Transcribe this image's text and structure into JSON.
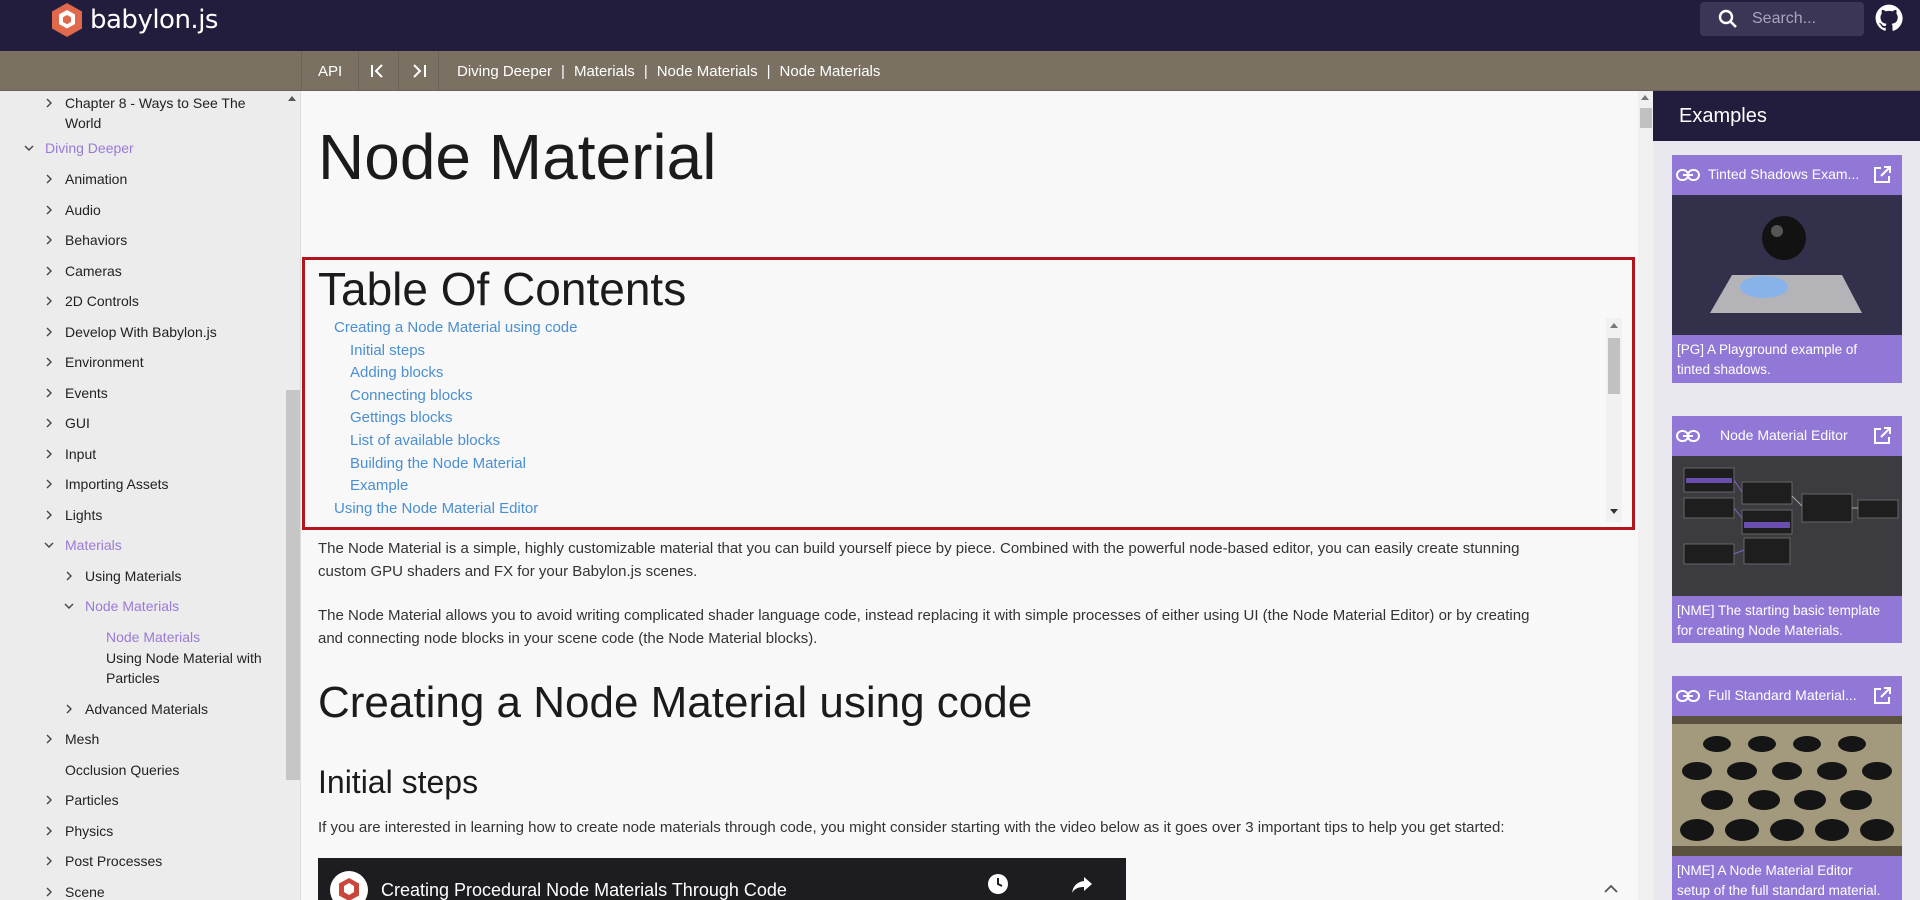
{
  "header": {
    "logo_text": "babylon.js",
    "search_placeholder": "Search..."
  },
  "toolbar": {
    "api_label": "API",
    "prev_icon": "first-page-icon",
    "next_icon": "last-page-icon",
    "breadcrumbs": [
      "Diving Deeper",
      "Materials",
      "Node Materials",
      "Node Materials"
    ],
    "separator": "|"
  },
  "sidebar": {
    "items": [
      {
        "label": "Chapter 8 - Ways to See The",
        "label2": "World",
        "chevron": "right"
      },
      {
        "label": "Diving Deeper",
        "chevron": "down",
        "active": true
      },
      {
        "label": "Animation",
        "chevron": "right"
      },
      {
        "label": "Audio",
        "chevron": "right"
      },
      {
        "label": "Behaviors",
        "chevron": "right"
      },
      {
        "label": "Cameras",
        "chevron": "right"
      },
      {
        "label": "2D Controls",
        "chevron": "right"
      },
      {
        "label": "Develop With Babylon.js",
        "chevron": "right"
      },
      {
        "label": "Environment",
        "chevron": "right"
      },
      {
        "label": "Events",
        "chevron": "right"
      },
      {
        "label": "GUI",
        "chevron": "right"
      },
      {
        "label": "Input",
        "chevron": "right"
      },
      {
        "label": "Importing Assets",
        "chevron": "right"
      },
      {
        "label": "Lights",
        "chevron": "right"
      },
      {
        "label": "Materials",
        "chevron": "down",
        "active": true
      },
      {
        "label": "Using Materials",
        "chevron": "right"
      },
      {
        "label": "Node Materials",
        "chevron": "down",
        "active": true
      },
      {
        "label": "Node Materials",
        "active": true
      },
      {
        "label": "Using Node Material with",
        "label2": "Particles"
      },
      {
        "label": "Advanced Materials",
        "chevron": "right"
      },
      {
        "label": "Mesh",
        "chevron": "right"
      },
      {
        "label": "Occlusion Queries"
      },
      {
        "label": "Particles",
        "chevron": "right"
      },
      {
        "label": "Physics",
        "chevron": "right"
      },
      {
        "label": "Post Processes",
        "chevron": "right"
      },
      {
        "label": "Scene",
        "chevron": "right"
      }
    ]
  },
  "main": {
    "title": "Node Material",
    "toc_title": "Table Of Contents",
    "toc": [
      {
        "label": "Creating a Node Material using code",
        "level": 1
      },
      {
        "label": "Initial steps",
        "level": 2
      },
      {
        "label": "Adding blocks",
        "level": 2
      },
      {
        "label": "Connecting blocks",
        "level": 2
      },
      {
        "label": "Gettings blocks",
        "level": 2
      },
      {
        "label": "List of available blocks",
        "level": 2
      },
      {
        "label": "Building the Node Material",
        "level": 2
      },
      {
        "label": "Example",
        "level": 2
      },
      {
        "label": "Using the Node Material Editor",
        "level": 1
      }
    ],
    "para1_line1": "The Node Material is a simple, highly customizable material that you can build yourself piece by piece. Combined with the powerful node-based editor, you can easily create stunning",
    "para1_line2": "custom GPU shaders and FX for your Babylon.js scenes.",
    "para2_line1": "The Node Material allows you to avoid writing complicated shader language code, instead replacing it with simple processes of either using UI (the Node Material Editor) or by creating",
    "para2_line2": "and connecting node blocks in your scene code (the Node Material blocks).",
    "h2": "Creating a Node Material using code",
    "h3": "Initial steps",
    "para3": "If you are interested in learning how to create node materials through code, you might consider starting with the video below as it goes over 3 important tips to help you get started:",
    "video_title": "Creating Procedural Node Materials Through Code"
  },
  "examples": {
    "heading": "Examples",
    "cards": [
      {
        "title": "Tinted Shadows Exam...",
        "desc_line1": "[PG] A Playground example of",
        "desc_line2": "tinted shadows."
      },
      {
        "title": "Node Material Editor",
        "desc_line1": "[NME] The starting basic template",
        "desc_line2": "for creating Node Materials."
      },
      {
        "title": "Full Standard Material...",
        "desc_line1": "[NME] A Node Material Editor",
        "desc_line2": "setup of the full standard material."
      }
    ]
  },
  "colors": {
    "header_bg": "#221d3d",
    "breadcrumb_bg": "#7b7163",
    "accent": "#9178d6",
    "link": "#4a8fd1",
    "highlight_border": "#b3141e"
  }
}
